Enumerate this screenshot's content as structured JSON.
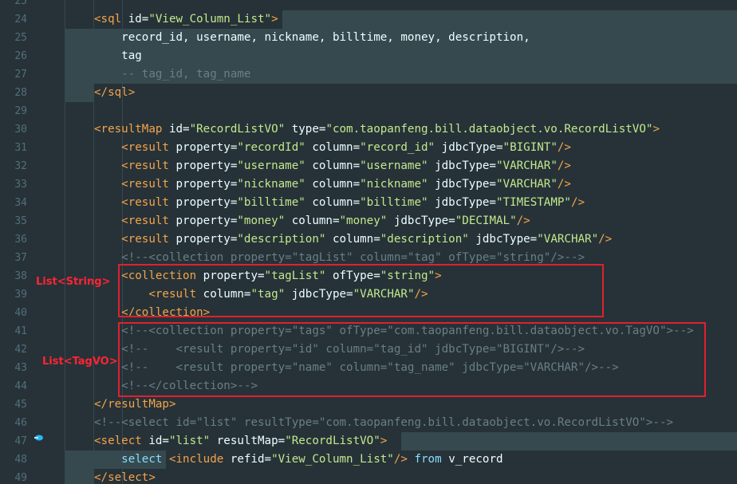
{
  "editor": {
    "lines": [
      {
        "n": "25",
        "segs": []
      },
      {
        "n": "24",
        "segs": [
          {
            "c": "tag",
            "t": "<sql "
          },
          {
            "c": "attr",
            "t": "id="
          },
          {
            "c": "val",
            "t": "\"View_Column_List\""
          },
          {
            "c": "tag",
            "t": ">"
          }
        ]
      },
      {
        "n": "25",
        "segs": [
          {
            "c": "t",
            "t": "    record_id, username, nickname, billtime, money, description,"
          }
        ]
      },
      {
        "n": "26",
        "segs": [
          {
            "c": "t",
            "t": "    tag"
          }
        ]
      },
      {
        "n": "27",
        "segs": [
          {
            "c": "cm",
            "t": "    -- tag_id, tag_name"
          }
        ]
      },
      {
        "n": "28",
        "segs": [
          {
            "c": "tag",
            "t": "</sql>"
          }
        ]
      },
      {
        "n": "29",
        "segs": []
      },
      {
        "n": "30",
        "segs": [
          {
            "c": "tag",
            "t": "<resultMap "
          },
          {
            "c": "attr",
            "t": "id="
          },
          {
            "c": "val",
            "t": "\"RecordListVO\""
          },
          {
            "c": "attr",
            "t": " type="
          },
          {
            "c": "val",
            "t": "\"com.taopanfeng.bill.dataobject.vo.RecordListVO\""
          },
          {
            "c": "tag",
            "t": ">"
          }
        ]
      },
      {
        "n": "31",
        "segs": [
          {
            "c": "tag",
            "t": "    <result "
          },
          {
            "c": "attr",
            "t": "property="
          },
          {
            "c": "val",
            "t": "\"recordId\""
          },
          {
            "c": "attr",
            "t": " column="
          },
          {
            "c": "val",
            "t": "\"record_id\""
          },
          {
            "c": "attr",
            "t": " jdbcType="
          },
          {
            "c": "val",
            "t": "\"BIGINT\""
          },
          {
            "c": "tag",
            "t": "/>"
          }
        ]
      },
      {
        "n": "32",
        "segs": [
          {
            "c": "tag",
            "t": "    <result "
          },
          {
            "c": "attr",
            "t": "property="
          },
          {
            "c": "val",
            "t": "\"username\""
          },
          {
            "c": "attr",
            "t": " column="
          },
          {
            "c": "val",
            "t": "\"username\""
          },
          {
            "c": "attr",
            "t": " jdbcType="
          },
          {
            "c": "val",
            "t": "\"VARCHAR\""
          },
          {
            "c": "tag",
            "t": "/>"
          }
        ]
      },
      {
        "n": "33",
        "segs": [
          {
            "c": "tag",
            "t": "    <result "
          },
          {
            "c": "attr",
            "t": "property="
          },
          {
            "c": "val",
            "t": "\"nickname\""
          },
          {
            "c": "attr",
            "t": " column="
          },
          {
            "c": "val",
            "t": "\"nickname\""
          },
          {
            "c": "attr",
            "t": " jdbcType="
          },
          {
            "c": "val",
            "t": "\"VARCHAR\""
          },
          {
            "c": "tag",
            "t": "/>"
          }
        ]
      },
      {
        "n": "34",
        "segs": [
          {
            "c": "tag",
            "t": "    <result "
          },
          {
            "c": "attr",
            "t": "property="
          },
          {
            "c": "val",
            "t": "\"billtime\""
          },
          {
            "c": "attr",
            "t": " column="
          },
          {
            "c": "val",
            "t": "\"billtime\""
          },
          {
            "c": "attr",
            "t": " jdbcType="
          },
          {
            "c": "val",
            "t": "\"TIMESTAMP\""
          },
          {
            "c": "tag",
            "t": "/>"
          }
        ]
      },
      {
        "n": "35",
        "segs": [
          {
            "c": "tag",
            "t": "    <result "
          },
          {
            "c": "attr",
            "t": "property="
          },
          {
            "c": "val",
            "t": "\"money\""
          },
          {
            "c": "attr",
            "t": " column="
          },
          {
            "c": "val",
            "t": "\"money\""
          },
          {
            "c": "attr",
            "t": " jdbcType="
          },
          {
            "c": "val",
            "t": "\"DECIMAL\""
          },
          {
            "c": "tag",
            "t": "/>"
          }
        ]
      },
      {
        "n": "36",
        "segs": [
          {
            "c": "tag",
            "t": "    <result "
          },
          {
            "c": "attr",
            "t": "property="
          },
          {
            "c": "val",
            "t": "\"description\""
          },
          {
            "c": "attr",
            "t": " column="
          },
          {
            "c": "val",
            "t": "\"description\""
          },
          {
            "c": "attr",
            "t": " jdbcType="
          },
          {
            "c": "val",
            "t": "\"VARCHAR\""
          },
          {
            "c": "tag",
            "t": "/>"
          }
        ]
      },
      {
        "n": "37",
        "segs": [
          {
            "c": "cm",
            "t": "    <!--<collection property=\"tagList\" column=\"tag\" ofType=\"string\"/>-->"
          }
        ]
      },
      {
        "n": "38",
        "segs": [
          {
            "c": "tag",
            "t": "    <collection "
          },
          {
            "c": "attr",
            "t": "property="
          },
          {
            "c": "val",
            "t": "\"tagList\""
          },
          {
            "c": "attr",
            "t": " ofType="
          },
          {
            "c": "val",
            "t": "\"string\""
          },
          {
            "c": "tag",
            "t": ">"
          }
        ]
      },
      {
        "n": "39",
        "segs": [
          {
            "c": "tag",
            "t": "        <result "
          },
          {
            "c": "attr",
            "t": "column="
          },
          {
            "c": "val",
            "t": "\"tag\""
          },
          {
            "c": "attr",
            "t": " jdbcType="
          },
          {
            "c": "val",
            "t": "\"VARCHAR\""
          },
          {
            "c": "tag",
            "t": "/>"
          }
        ]
      },
      {
        "n": "40",
        "segs": [
          {
            "c": "tag",
            "t": "    </collection>"
          }
        ]
      },
      {
        "n": "41",
        "segs": [
          {
            "c": "cm",
            "t": "    <!--<collection property=\"tags\" ofType=\"com.taopanfeng.bill.dataobject.vo.TagVO\">-->"
          }
        ]
      },
      {
        "n": "42",
        "segs": [
          {
            "c": "cm",
            "t": "    <!--    <result property=\"id\" column=\"tag_id\" jdbcType=\"BIGINT\"/>-->"
          }
        ]
      },
      {
        "n": "43",
        "segs": [
          {
            "c": "cm",
            "t": "    <!--    <result property=\"name\" column=\"tag_name\" jdbcType=\"VARCHAR\"/>-->"
          }
        ]
      },
      {
        "n": "44",
        "segs": [
          {
            "c": "cm",
            "t": "    <!--</collection>-->"
          }
        ]
      },
      {
        "n": "45",
        "segs": [
          {
            "c": "tag",
            "t": "</resultMap>"
          }
        ]
      },
      {
        "n": "46",
        "segs": [
          {
            "c": "cm",
            "t": "<!--<select id=\"list\" resultType=\"com.taopanfeng.bill.dataobject.vo.RecordListVO\">-->"
          }
        ]
      },
      {
        "n": "47",
        "segs": [
          {
            "c": "tag",
            "t": "<select "
          },
          {
            "c": "attr",
            "t": "id="
          },
          {
            "c": "val",
            "t": "\"list\""
          },
          {
            "c": "attr",
            "t": " resultMap="
          },
          {
            "c": "val",
            "t": "\"RecordListVO\""
          },
          {
            "c": "tag",
            "t": ">"
          }
        ]
      },
      {
        "n": "48",
        "segs": [
          {
            "c": "kw",
            "t": "    select "
          },
          {
            "c": "tag",
            "t": "<include "
          },
          {
            "c": "attr",
            "t": "refid="
          },
          {
            "c": "val",
            "t": "\"View_Column_List\""
          },
          {
            "c": "tag",
            "t": "/>"
          },
          {
            "c": "kw",
            "t": " from"
          },
          {
            "c": "t",
            "t": " v_record"
          }
        ]
      },
      {
        "n": "49",
        "segs": [
          {
            "c": "tag",
            "t": "</select>"
          }
        ]
      }
    ]
  },
  "annotations": {
    "list_string_label": "List<String>",
    "list_tagvo_label": "List<TagVO>"
  },
  "colors": {
    "background": "#263238",
    "tag": "#f4a34a",
    "value": "#c3e88d",
    "comment": "#697f86",
    "annotation": "#e0202f"
  }
}
